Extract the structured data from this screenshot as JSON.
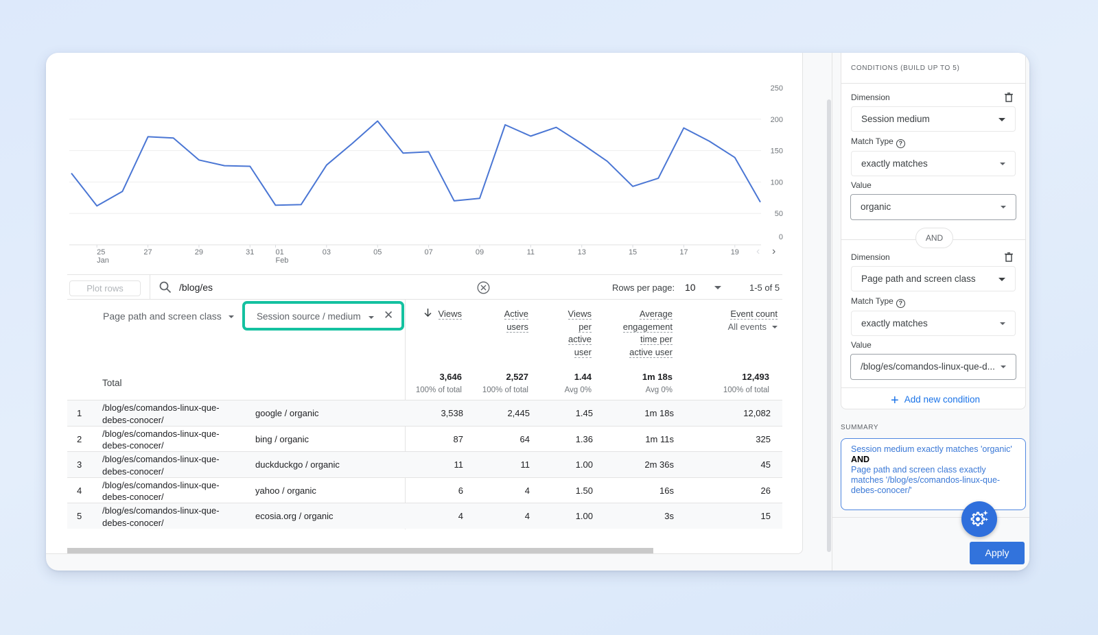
{
  "chart_data": {
    "type": "line",
    "title": "",
    "xlabel": "",
    "ylabel": "",
    "ylim": [
      0,
      250
    ],
    "y_ticks": [
      "0",
      "50",
      "100",
      "150",
      "200",
      "250"
    ],
    "grid": true,
    "y_axis_side": "right",
    "x": [
      "Jan 24",
      "Jan 25",
      "Jan 26",
      "Jan 27",
      "Jan 28",
      "Jan 29",
      "Jan 30",
      "Jan 31",
      "Feb 01",
      "Feb 02",
      "Feb 03",
      "Feb 04",
      "Feb 05",
      "Feb 06",
      "Feb 07",
      "Feb 08",
      "Feb 09",
      "Feb 10",
      "Feb 11",
      "Feb 12",
      "Feb 13",
      "Feb 14",
      "Feb 15",
      "Feb 16",
      "Feb 17",
      "Feb 18",
      "Feb 19",
      "Feb 20"
    ],
    "x_tick_labels": [
      {
        "index": 1,
        "day": "25",
        "month": "Jan"
      },
      {
        "index": 3,
        "day": "27",
        "month": ""
      },
      {
        "index": 5,
        "day": "29",
        "month": ""
      },
      {
        "index": 7,
        "day": "31",
        "month": ""
      },
      {
        "index": 8,
        "day": "01",
        "month": "Feb"
      },
      {
        "index": 10,
        "day": "03",
        "month": ""
      },
      {
        "index": 12,
        "day": "05",
        "month": ""
      },
      {
        "index": 14,
        "day": "07",
        "month": ""
      },
      {
        "index": 16,
        "day": "09",
        "month": ""
      },
      {
        "index": 18,
        "day": "11",
        "month": ""
      },
      {
        "index": 20,
        "day": "13",
        "month": ""
      },
      {
        "index": 22,
        "day": "15",
        "month": ""
      },
      {
        "index": 24,
        "day": "17",
        "month": ""
      },
      {
        "index": 26,
        "day": "19",
        "month": ""
      }
    ],
    "series": [
      {
        "name": "Views",
        "color": "#4a76d4",
        "values": [
          114,
          62,
          85,
          172,
          170,
          135,
          126,
          125,
          63,
          64,
          127,
          161,
          197,
          146,
          148,
          70,
          74,
          191,
          173,
          187,
          161,
          133,
          93,
          106,
          186,
          165,
          139,
          68
        ]
      }
    ]
  },
  "chart_nav": {
    "prev": "‹",
    "next": "›"
  },
  "toolbar": {
    "plot_rows_label": "Plot rows",
    "search_value": "/blog/es",
    "rows_per_page_label": "Rows per page:",
    "rows_per_page_value": "10",
    "range_text": "1-5 of 5"
  },
  "table": {
    "dimension_1": "Page path and screen class",
    "dimension_2": "Session source / medium",
    "metrics": [
      {
        "lines": [
          "Views"
        ],
        "sorted": true,
        "sub": ""
      },
      {
        "lines": [
          "Active",
          "users"
        ],
        "sorted": false,
        "sub": ""
      },
      {
        "lines": [
          "Views",
          "per",
          "active",
          "user"
        ],
        "sorted": false,
        "sub": ""
      },
      {
        "lines": [
          "Average",
          "engagement",
          "time per",
          "active user"
        ],
        "sorted": false,
        "sub": ""
      },
      {
        "lines": [
          "Event count"
        ],
        "sorted": false,
        "sub": "All events"
      }
    ],
    "total_label": "Total",
    "totals": [
      {
        "value": "3,646",
        "sub": "100% of total"
      },
      {
        "value": "2,527",
        "sub": "100% of total"
      },
      {
        "value": "1.44",
        "sub": "Avg 0%"
      },
      {
        "value": "1m 18s",
        "sub": "Avg 0%"
      },
      {
        "value": "12,493",
        "sub": "100% of total"
      }
    ],
    "rows": [
      {
        "num": "1",
        "path_1": "/blog/es/comandos-linux-que-",
        "path_2": "debes-conocer/",
        "source": "google / organic",
        "values": [
          "3,538",
          "2,445",
          "1.45",
          "1m 18s",
          "12,082"
        ]
      },
      {
        "num": "2",
        "path_1": "/blog/es/comandos-linux-que-",
        "path_2": "debes-conocer/",
        "source": "bing / organic",
        "values": [
          "87",
          "64",
          "1.36",
          "1m 11s",
          "325"
        ]
      },
      {
        "num": "3",
        "path_1": "/blog/es/comandos-linux-que-",
        "path_2": "debes-conocer/",
        "source": "duckduckgo / organic",
        "values": [
          "11",
          "11",
          "1.00",
          "2m 36s",
          "45"
        ]
      },
      {
        "num": "4",
        "path_1": "/blog/es/comandos-linux-que-",
        "path_2": "debes-conocer/",
        "source": "yahoo / organic",
        "values": [
          "6",
          "4",
          "1.50",
          "16s",
          "26"
        ]
      },
      {
        "num": "5",
        "path_1": "/blog/es/comandos-linux-que-",
        "path_2": "debes-conocer/",
        "source": "ecosia.org / organic",
        "values": [
          "4",
          "4",
          "1.00",
          "3s",
          "15"
        ]
      }
    ]
  },
  "conditions_panel": {
    "title": "CONDITIONS (BUILD UP TO 5)",
    "conditions": [
      {
        "dimension_label": "Dimension",
        "dimension_value": "Session medium",
        "match_type_label": "Match Type",
        "match_type_value": "exactly matches",
        "value_label": "Value",
        "value_value": "organic"
      },
      {
        "dimension_label": "Dimension",
        "dimension_value": "Page path and screen class",
        "match_type_label": "Match Type",
        "match_type_value": "exactly matches",
        "value_label": "Value",
        "value_value": "/blog/es/comandos-linux-que-d..."
      }
    ],
    "and_label": "AND",
    "add_condition_label": "Add new condition",
    "summary_label": "SUMMARY",
    "summary": {
      "line_1": "Session medium exactly matches 'organic'",
      "and": "AND",
      "line_2": "Page path and screen class exactly matches '/blog/es/comandos-linux-que-debes-conocer/'"
    },
    "apply_label": "Apply"
  },
  "colors": {
    "accent": "#1a73e8",
    "highlight": "#14c1a0",
    "line": "#4a76d4",
    "apply": "#3273dc"
  }
}
